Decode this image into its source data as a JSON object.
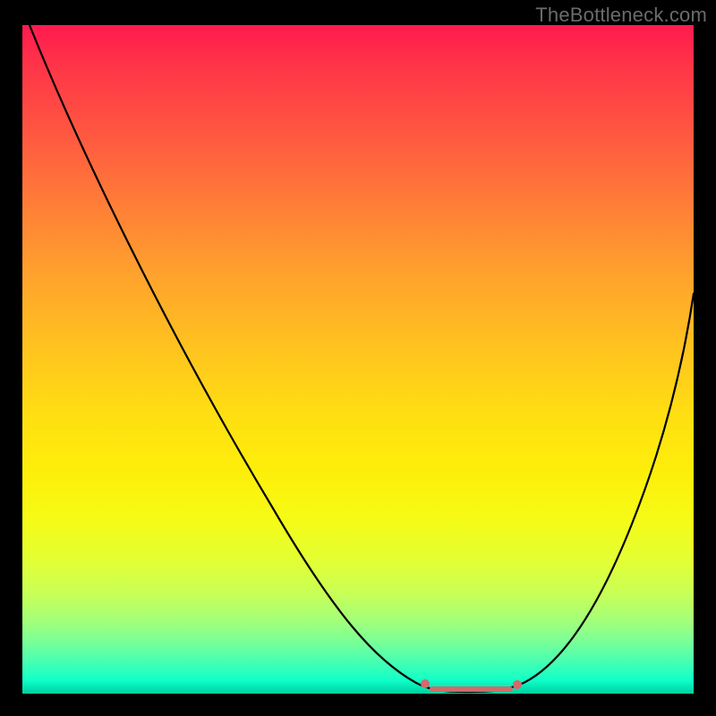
{
  "attribution": "TheBottleneck.com",
  "chart_data": {
    "type": "line",
    "title": "",
    "xlabel": "",
    "ylabel": "",
    "xlim": [
      0,
      100
    ],
    "ylim": [
      0,
      100
    ],
    "x": [
      0,
      5,
      10,
      15,
      20,
      25,
      30,
      35,
      40,
      45,
      50,
      55,
      60,
      62,
      64,
      68,
      72,
      74,
      76,
      80,
      85,
      90,
      95,
      100
    ],
    "values": [
      100,
      94,
      87,
      80,
      72,
      64,
      56,
      48,
      40,
      32,
      24,
      16,
      8,
      4,
      1.5,
      0,
      0,
      1.5,
      4,
      10,
      21,
      34,
      48,
      62
    ],
    "highlight_range": {
      "start_x": 60,
      "end_x": 75,
      "color": "#d46a6a"
    }
  }
}
